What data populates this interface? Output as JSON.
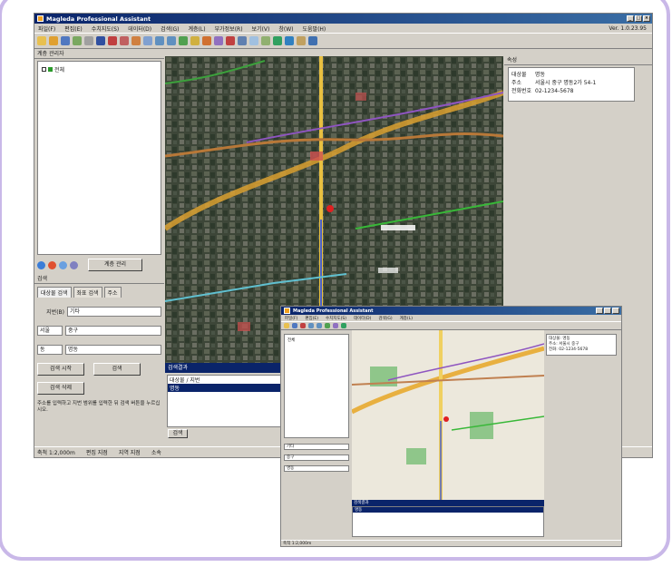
{
  "main_window": {
    "title": "Magleda Professional Assistant",
    "menus": [
      "파일(F)",
      "편집(E)",
      "수치지도(S)",
      "데이터(D)",
      "검색(G)",
      "계층(L)",
      "부가정보(R)",
      "보기(V)",
      "창(W)",
      "도움말(H)"
    ],
    "version": "Ver. 1.0.23.95",
    "layer_panel_title": "계층 관리자",
    "layer_root": "전체",
    "layer_manage_button": "계층 관리",
    "search_panel_title": "검색",
    "tabs": [
      "대상물 검색",
      "좌표 검색",
      "주소"
    ],
    "form": {
      "row1_label": "지번(B)",
      "row1_value": "기타",
      "row2_label": "서울",
      "row2_value": "중구",
      "row3_label": "동",
      "row3_value": "명동",
      "search_button": "검색 시작",
      "search_button2": "검색",
      "delete_button": "검색 삭제",
      "note": "주소를 입력하고 지번 범위를 입력한 뒤 검색 버튼을 누르십시오."
    },
    "results": {
      "header": "검색결과",
      "col1": "대상물 / 지번",
      "selected_row": "명동",
      "footer_tab": "검색"
    },
    "info_panel_title": "속성",
    "info": [
      {
        "k": "대상물",
        "v": "명동"
      },
      {
        "k": "주소",
        "v": "서울시 중구 명동2가 54-1"
      },
      {
        "k": "전화번호",
        "v": "02-1234-5678"
      }
    ],
    "status": [
      "축척 1:2,000m",
      "편집 지점",
      "지역 지점",
      "소속"
    ]
  },
  "second_window": {
    "title": "Magleda Professional Assistant",
    "layer_root": "전체",
    "results_header": "검색결과",
    "info": [
      "대상물: 명동",
      "주소: 서울시 중구",
      "전화: 02-1234-5678"
    ]
  }
}
